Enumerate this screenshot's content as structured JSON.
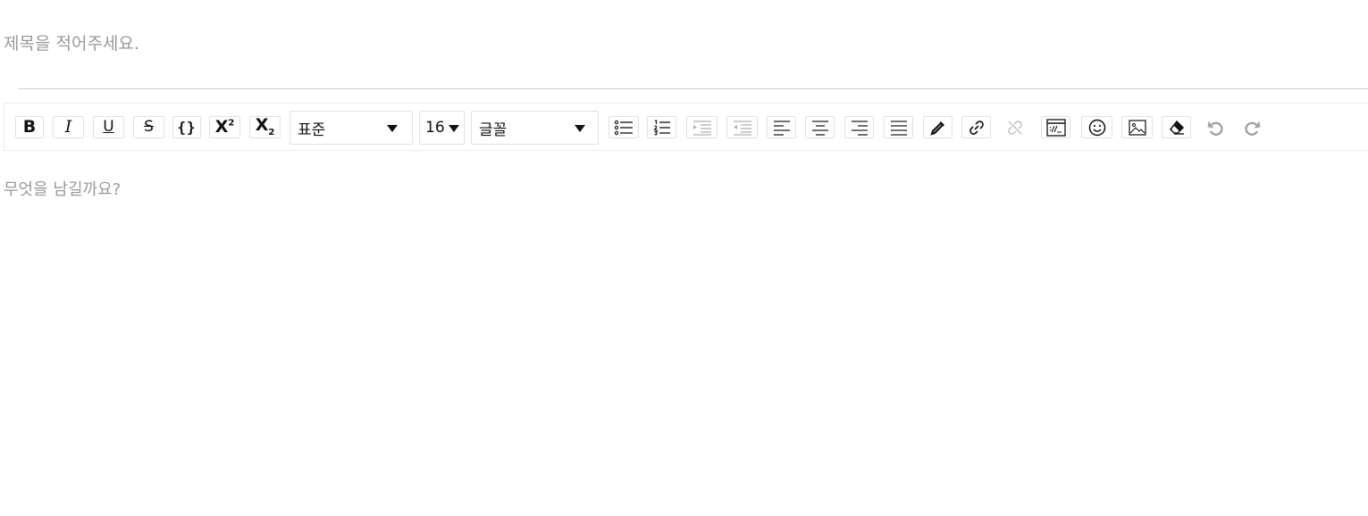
{
  "title": {
    "placeholder": "제목을 적어주세요.",
    "value": ""
  },
  "toolbar": {
    "bold": "B",
    "italic": "I",
    "underline": "U",
    "strike": "S",
    "code": "{}",
    "superscript_base": "X",
    "superscript_mark": "2",
    "subscript_base": "X",
    "subscript_mark": "2",
    "format_select": "표준",
    "size_select": "16",
    "font_select": "글꼴"
  },
  "editor": {
    "placeholder": "무엇을 남길까요?"
  }
}
